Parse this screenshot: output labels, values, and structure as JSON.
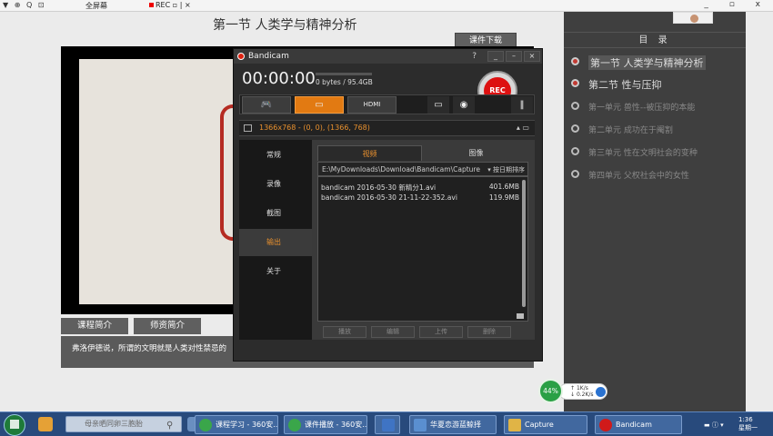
{
  "topbar": {
    "icons": "▼ ⊕ Q ⊡",
    "fullscreen_label": "全屏幕",
    "rec_label": "REC",
    "window_controls": "_ ▫ x"
  },
  "course": {
    "lesson_title": "第一节 人类学与精神分析",
    "download_label": "课件下载",
    "tabs": [
      "课程简介",
      "师资简介"
    ],
    "description": "弗洛伊德说，所谓的文明就是人类对性禁忌的"
  },
  "toc": {
    "header": "目 录",
    "items": [
      {
        "label": "第一节 人类学与精神分析",
        "state": "current"
      },
      {
        "label": "第二节 性与压抑",
        "state": "done"
      },
      {
        "label": "第一单元 兽性--被压抑的本能",
        "state": "pending"
      },
      {
        "label": "第二单元 成功在于阉割",
        "state": "pending"
      },
      {
        "label": "第三单元 性在文明社会的变种",
        "state": "pending"
      },
      {
        "label": "第四单元 父权社会中的女性",
        "state": "pending"
      }
    ]
  },
  "bandicam": {
    "title": "Bandicam",
    "help": "?",
    "win_buttons": [
      "_",
      "–",
      "×"
    ],
    "timer": "00:00:00",
    "size_text": "0 bytes / 95.4GB",
    "rec_label": "REC",
    "resolution": "1366x768 - (0, 0), (1366, 768)",
    "modes": [
      {
        "name": "game",
        "icon": "gamepad-icon",
        "glyph": "🎮"
      },
      {
        "name": "screen",
        "icon": "screen-rect-icon",
        "glyph": "▭"
      },
      {
        "name": "hdmi",
        "icon": "hdmi-icon",
        "glyph": "HDMI"
      }
    ],
    "nav": [
      "常规",
      "录像",
      "截图",
      "输出",
      "关于"
    ],
    "nav_active": 3,
    "panel_tabs": [
      "视频",
      "图像"
    ],
    "path": "E:\\MyDownloads\\Download\\Bandicam\\Capture",
    "sort_label": "▾ 按日期排序",
    "files": [
      {
        "name": "bandicam 2016-05-30 新精分1.avi",
        "size": "401.6MB"
      },
      {
        "name": "bandicam 2016-05-30 21-11-22-352.avi",
        "size": "119.9MB"
      }
    ],
    "actions": [
      "播放",
      "编辑",
      "上传",
      "删除"
    ]
  },
  "speed": {
    "percent": "44%",
    "up": "1K/s",
    "down": "0.2K/s"
  },
  "taskbar": {
    "search_placeholder": "母亲晒同卵三胞胎",
    "tasks": [
      {
        "label": "课程学习 - 360安...",
        "color": "#3aa64a"
      },
      {
        "label": "课件播放 - 360安...",
        "color": "#3aa64a"
      },
      {
        "label": "",
        "color": "#3f74c4"
      },
      {
        "label": "华夏恋游蓝鲸择",
        "color": "#5a8fd0"
      },
      {
        "label": "Capture",
        "color": "#e0b446"
      },
      {
        "label": "Bandicam",
        "color": "#d01a1a"
      }
    ],
    "clock_time": "1:36",
    "clock_day": "星期一"
  }
}
